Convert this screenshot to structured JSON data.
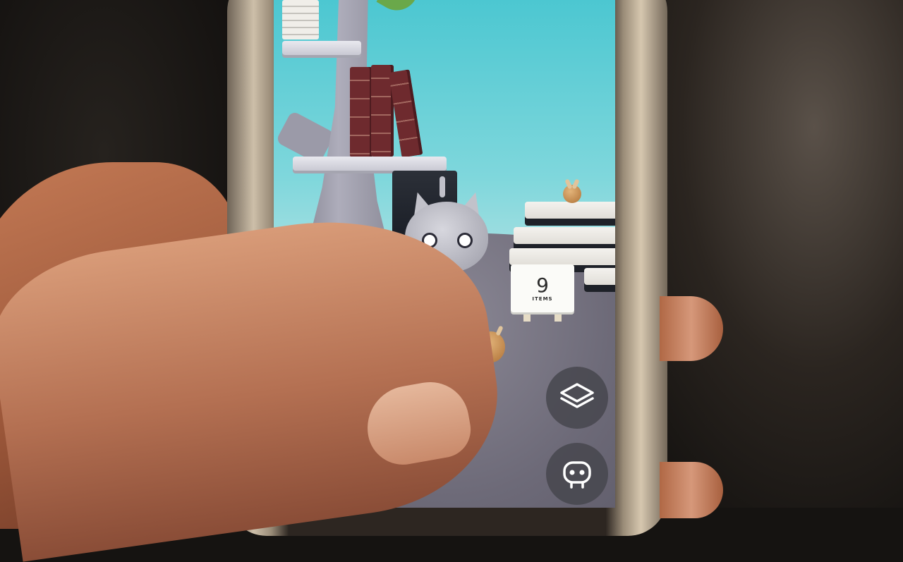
{
  "scene": {
    "type": "photo of a smartphone running a 3D pet game",
    "sky_color": "#7fd7dc",
    "ground_color": "#7b7886"
  },
  "sign": {
    "count": "9",
    "label": "ITEMS"
  },
  "hud": {
    "layers_button_icon": "layers-icon",
    "character_button_icon": "character-face-icon"
  }
}
